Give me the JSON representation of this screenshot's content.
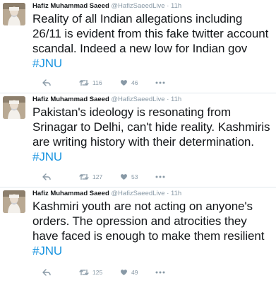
{
  "tweets": [
    {
      "name": "Hafiz Muhammad Saeed",
      "handle": "@HafizSaeedLive",
      "separator": "·",
      "time": "11h",
      "text": "Reality of all Indian allegations including 26/11 is evident from this fake twitter account scandal. Indeed a new low for Indian gov ",
      "hashtag": "#JNU",
      "retweets": "116",
      "likes": "46"
    },
    {
      "name": "Hafiz Muhammad Saeed",
      "handle": "@HafizSaeedLive",
      "separator": "·",
      "time": "11h",
      "text": "Pakistan's ideology is resonating from Srinagar to Delhi, can't hide reality. Kashmiris are writing history with their determination. ",
      "hashtag": "#JNU",
      "retweets": "127",
      "likes": "53"
    },
    {
      "name": "Hafiz Muhammad Saeed",
      "handle": "@HafizSaeedLive",
      "separator": "·",
      "time": "11h",
      "text": "Kashmiri youth are not acting on anyone's orders. The opression and atrocities they have faced is enough to make them resilient ",
      "hashtag": "#JNU",
      "retweets": "125",
      "likes": "49"
    }
  ],
  "icons": {
    "reply": "reply-icon",
    "retweet": "retweet-icon",
    "like": "heart-icon",
    "more": "more-icon"
  },
  "colors": {
    "hashtag": "#1b95e0",
    "meta": "#8899a6",
    "text": "#14171a",
    "divider": "#e1e8ed"
  }
}
